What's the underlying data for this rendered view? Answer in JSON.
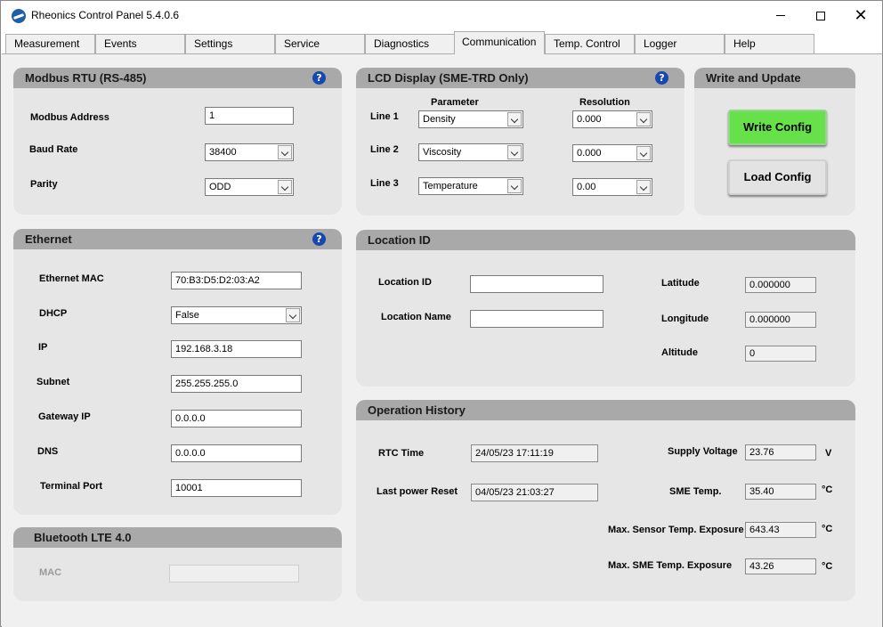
{
  "window": {
    "title": "Rheonics Control Panel 5.4.0.6",
    "controls": {
      "minimize": "minimize",
      "maximize": "maximize",
      "close": "✕"
    }
  },
  "tabs": [
    "Measurement",
    "Events",
    "Settings",
    "Service",
    "Diagnostics",
    "Communication",
    "Temp. Control",
    "Logger",
    "Help"
  ],
  "active_tab": "Communication",
  "modbus": {
    "title": "Modbus RTU (RS-485)",
    "help": "?",
    "address_label": "Modbus Address",
    "address_value": "1",
    "baud_label": "Baud Rate",
    "baud_value": "38400",
    "parity_label": "Parity",
    "parity_value": "ODD"
  },
  "lcd": {
    "title": "LCD Display (SME-TRD Only)",
    "help": "?",
    "param_header": "Parameter",
    "res_header": "Resolution",
    "lines": [
      {
        "label": "Line 1",
        "parameter": "Density",
        "resolution": "0.000"
      },
      {
        "label": "Line 2",
        "parameter": "Viscosity",
        "resolution": "0.000"
      },
      {
        "label": "Line 3",
        "parameter": "Temperature",
        "resolution": "0.00"
      }
    ]
  },
  "write_update": {
    "title": "Write and Update",
    "write_label": "Write Config",
    "load_label": "Load Config"
  },
  "ethernet": {
    "title": "Ethernet",
    "help": "?",
    "mac_label": "Ethernet MAC",
    "mac_value": "70:B3:D5:D2:03:A2",
    "dhcp_label": "DHCP",
    "dhcp_value": "False",
    "ip_label": "IP",
    "ip_value": "192.168.3.18",
    "subnet_label": "Subnet",
    "subnet_value": "255.255.255.0",
    "gateway_label": "Gateway IP",
    "gateway_value": "0.0.0.0",
    "dns_label": "DNS",
    "dns_value": "0.0.0.0",
    "port_label": "Terminal Port",
    "port_value": "10001"
  },
  "location": {
    "title": "Location ID",
    "id_label": "Location ID",
    "id_value": "",
    "name_label": "Location Name",
    "name_value": "",
    "lat_label": "Latitude",
    "lat_value": "0.000000",
    "lon_label": "Longitude",
    "lon_value": "0.000000",
    "alt_label": "Altitude",
    "alt_value": "0"
  },
  "history": {
    "title": "Operation History",
    "rtc_label": "RTC Time",
    "rtc_value": "24/05/23 17:11:19",
    "reset_label": "Last power Reset",
    "reset_value": "04/05/23 21:03:27",
    "supply_label": "Supply Voltage",
    "supply_value": "23.76",
    "supply_unit": "V",
    "sme_temp_label": "SME Temp.",
    "sme_temp_value": "35.40",
    "sme_temp_unit": "°C",
    "max_sensor_label": "Max. Sensor Temp. Exposure",
    "max_sensor_value": "643.43",
    "max_sensor_unit": "°C",
    "max_sme_label": "Max. SME Temp. Exposure",
    "max_sme_value": "43.26",
    "max_sme_unit": "°C"
  },
  "bluetooth": {
    "title": "Bluetooth LTE 4.0",
    "mac_label": "MAC",
    "mac_value": ""
  }
}
